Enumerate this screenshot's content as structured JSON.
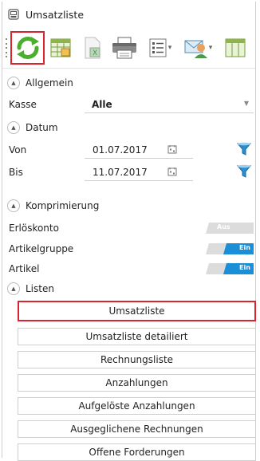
{
  "window": {
    "title": "Umsatzliste"
  },
  "toolbar": {
    "icons": [
      "refresh-icon",
      "grid-icon",
      "excel-export-icon",
      "print-icon",
      "list-options-icon",
      "email-icon",
      "grid-layout-icon"
    ],
    "dropdown_glyph": "▾"
  },
  "sections": {
    "allgemein": "Allgemein",
    "datum": "Datum",
    "komprimierung": "Komprimierung",
    "listen": "Listen",
    "collapse_glyph": "▲"
  },
  "allgemein": {
    "kasse_label": "Kasse",
    "kasse_value": "Alle",
    "caret_glyph": "▼"
  },
  "datum": {
    "von_label": "Von",
    "von_value": "01.07.2017",
    "bis_label": "Bis",
    "bis_value": "11.07.2017"
  },
  "komprimierung": {
    "rows": [
      {
        "label": "Erlöskonto",
        "state": "Aus",
        "on": false
      },
      {
        "label": "Artikelgruppe",
        "state": "Ein",
        "on": true
      },
      {
        "label": "Artikel",
        "state": "Ein",
        "on": true
      }
    ]
  },
  "listen": {
    "buttons": [
      "Umsatzliste",
      "Umsatzliste detailiert",
      "Rechnungsliste",
      "Anzahlungen",
      "Aufgelöste Anzahlungen",
      "Ausgeglichene Rechnungen",
      "Offene Forderungen"
    ]
  },
  "colors": {
    "highlight": "#d9232d",
    "toggle_on": "#1a8fd8",
    "toggle_off": "#dcdcdc",
    "funnel": "#2a8fd0"
  }
}
